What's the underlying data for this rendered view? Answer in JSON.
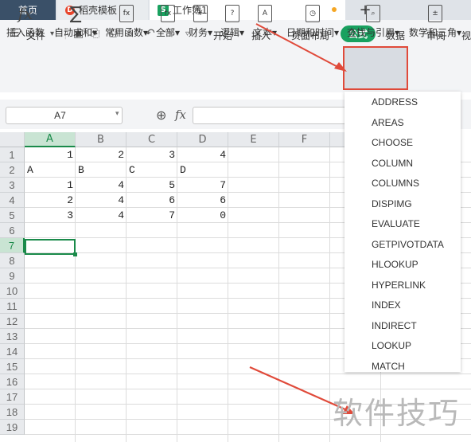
{
  "tabs": {
    "home": "首页",
    "template": "稻壳模板",
    "workbook": "工作簿1",
    "add": "+"
  },
  "menu": {
    "file": "文件",
    "items": [
      "开始",
      "插入",
      "页面布局",
      "公式",
      "数据",
      "审阅",
      "视"
    ]
  },
  "ribbon": {
    "buttons": [
      "插入函数",
      "自动求和",
      "常用函数",
      "全部",
      "财务",
      "逻辑",
      "文本",
      "日期和时间",
      "查找与引用",
      "数学和三角"
    ]
  },
  "formula_bar": {
    "name_box": "A7",
    "fx": "fx"
  },
  "sheet": {
    "columns": [
      "A",
      "B",
      "C",
      "D",
      "E",
      "F",
      "G"
    ],
    "rows": [
      "1",
      "2",
      "3",
      "4",
      "5",
      "6",
      "7",
      "8",
      "9",
      "10",
      "11",
      "12",
      "13",
      "14",
      "15",
      "16",
      "17",
      "18",
      "19"
    ],
    "cells": [
      [
        "1",
        "2",
        "3",
        "4"
      ],
      [
        "A",
        "B",
        "C",
        "D"
      ],
      [
        "1",
        "4",
        "5",
        "7"
      ],
      [
        "2",
        "4",
        "6",
        "6"
      ],
      [
        "3",
        "4",
        "7",
        "0"
      ]
    ],
    "active_cell": "A7"
  },
  "lookup_menu": {
    "items": [
      "ADDRESS",
      "AREAS",
      "CHOOSE",
      "COLUMN",
      "COLUMNS",
      "DISPIMG",
      "EVALUATE",
      "GETPIVOTDATA",
      "HLOOKUP",
      "HYPERLINK",
      "INDEX",
      "INDIRECT",
      "LOOKUP",
      "MATCH"
    ]
  },
  "watermark": "软件技巧",
  "colors": {
    "accent_green": "#19a15f",
    "highlight_red": "#e04a3a",
    "tab_dark": "#3a5068"
  }
}
